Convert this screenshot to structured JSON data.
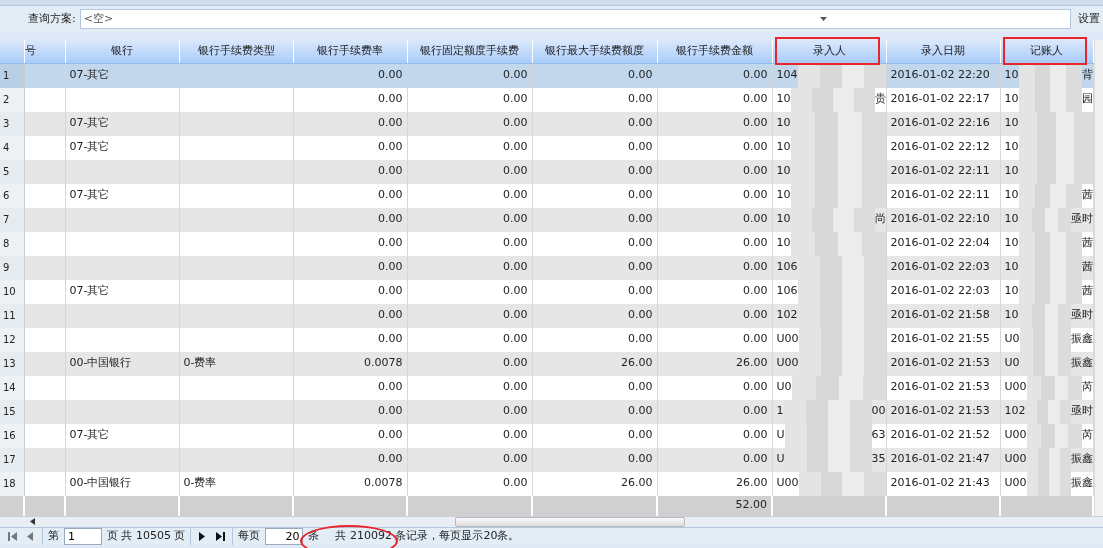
{
  "query": {
    "label": "查询方案:",
    "value": "<空>",
    "settings_button": "设置"
  },
  "table": {
    "columns": [
      {
        "label": "号",
        "highlighted": false
      },
      {
        "label": "银行",
        "highlighted": false
      },
      {
        "label": "银行手续费类型",
        "highlighted": false
      },
      {
        "label": "银行手续费率",
        "highlighted": false
      },
      {
        "label": "银行固定额度手续费",
        "highlighted": false
      },
      {
        "label": "银行最大手续费额度",
        "highlighted": false
      },
      {
        "label": "银行手续费金额",
        "highlighted": false
      },
      {
        "label": "录入人",
        "highlighted": true
      },
      {
        "label": "录入日期",
        "highlighted": false
      },
      {
        "label": "记账人",
        "highlighted": true
      }
    ],
    "rows": [
      {
        "number": "1",
        "selected": true,
        "bank": "07-其它",
        "rate": "0.00",
        "fixed": "0.00",
        "max": "0.00",
        "amount": "0.00",
        "entered_by": {
          "start": "104"
        },
        "entry_date": "2016-01-02 22:20",
        "bookkeeper": {
          "start": "10",
          "end": "背"
        }
      },
      {
        "number": "2",
        "selected": false,
        "rate": "0.00",
        "fixed": "0.00",
        "max": "0.00",
        "amount": "0.00",
        "entered_by": {
          "start": "10",
          "end": "贵"
        },
        "entry_date": "2016-01-02 22:17",
        "bookkeeper": {
          "start": "10",
          "end": "园"
        }
      },
      {
        "number": "3",
        "selected": false,
        "bank": "07-其它",
        "rate": "0.00",
        "fixed": "0.00",
        "max": "0.00",
        "amount": "0.00",
        "entered_by": {
          "start": "10"
        },
        "entry_date": "2016-01-02 22:16",
        "bookkeeper": {
          "start": "10"
        }
      },
      {
        "number": "4",
        "selected": false,
        "bank": "07-其它",
        "rate": "0.00",
        "fixed": "0.00",
        "max": "0.00",
        "amount": "0.00",
        "entered_by": {
          "start": "10"
        },
        "entry_date": "2016-01-02 22:12",
        "bookkeeper": {
          "start": "10"
        }
      },
      {
        "number": "5",
        "selected": false,
        "rate": "0.00",
        "fixed": "0.00",
        "max": "0.00",
        "amount": "0.00",
        "entered_by": {
          "start": "10"
        },
        "entry_date": "2016-01-02 22:11",
        "bookkeeper": {
          "start": "10"
        }
      },
      {
        "number": "6",
        "selected": false,
        "bank": "07-其它",
        "rate": "0.00",
        "fixed": "0.00",
        "max": "0.00",
        "amount": "0.00",
        "entered_by": {
          "start": "10"
        },
        "entry_date": "2016-01-02 22:11",
        "bookkeeper": {
          "start": "10",
          "end": "茜"
        }
      },
      {
        "number": "7",
        "selected": false,
        "rate": "0.00",
        "fixed": "0.00",
        "max": "0.00",
        "amount": "0.00",
        "entered_by": {
          "start": "10",
          "end": "尚"
        },
        "entry_date": "2016-01-02 22:10",
        "bookkeeper": {
          "start": "10",
          "end": "亟时"
        }
      },
      {
        "number": "8",
        "selected": false,
        "rate": "0.00",
        "fixed": "0.00",
        "max": "0.00",
        "amount": "0.00",
        "entered_by": {
          "start": "10"
        },
        "entry_date": "2016-01-02 22:04",
        "bookkeeper": {
          "start": "10",
          "end": "茜"
        }
      },
      {
        "number": "9",
        "selected": false,
        "rate": "0.00",
        "fixed": "0.00",
        "max": "0.00",
        "amount": "0.00",
        "entered_by": {
          "start": "106"
        },
        "entry_date": "2016-01-02 22:03",
        "bookkeeper": {
          "start": "10",
          "end": "茜"
        }
      },
      {
        "number": "10",
        "selected": false,
        "bank": "07-其它",
        "rate": "0.00",
        "fixed": "0.00",
        "max": "0.00",
        "amount": "0.00",
        "entered_by": {
          "start": "106"
        },
        "entry_date": "2016-01-02 22:03",
        "bookkeeper": {
          "start": "10",
          "end": "茜"
        }
      },
      {
        "number": "11",
        "selected": false,
        "rate": "0.00",
        "fixed": "0.00",
        "max": "0.00",
        "amount": "0.00",
        "entered_by": {
          "start": "102"
        },
        "entry_date": "2016-01-02 21:58",
        "bookkeeper": {
          "start": "10",
          "end": "亟时"
        }
      },
      {
        "number": "12",
        "selected": false,
        "rate": "0.00",
        "fixed": "0.00",
        "max": "0.00",
        "amount": "0.00",
        "entered_by": {
          "start": "U00"
        },
        "entry_date": "2016-01-02 21:55",
        "bookkeeper": {
          "start": "U0",
          "end": "振鑫"
        }
      },
      {
        "number": "13",
        "selected": false,
        "bank": "00-中国银行",
        "fee_type": "0-费率",
        "rate": "0.0078",
        "fixed": "0.00",
        "max": "26.00",
        "amount": "26.00",
        "entered_by": {
          "start": "U00"
        },
        "entry_date": "2016-01-02 21:53",
        "bookkeeper": {
          "start": "U0",
          "end": "振鑫"
        }
      },
      {
        "number": "14",
        "selected": false,
        "rate": "0.00",
        "fixed": "0.00",
        "max": "0.00",
        "amount": "0.00",
        "entered_by": {
          "start": "U0"
        },
        "entry_date": "2016-01-02 21:53",
        "bookkeeper": {
          "start": "U00",
          "end": "芮"
        }
      },
      {
        "number": "15",
        "selected": false,
        "rate": "0.00",
        "fixed": "0.00",
        "max": "0.00",
        "amount": "0.00",
        "entered_by": {
          "start": "1",
          "end": "00"
        },
        "entry_date": "2016-01-02 21:53",
        "bookkeeper": {
          "start": "102",
          "end": "亟时"
        }
      },
      {
        "number": "16",
        "selected": false,
        "bank": "07-其它",
        "rate": "0.00",
        "fixed": "0.00",
        "max": "0.00",
        "amount": "0.00",
        "entered_by": {
          "start": "U",
          "end": "63"
        },
        "entry_date": "2016-01-02 21:52",
        "bookkeeper": {
          "start": "U00",
          "end": "芮"
        }
      },
      {
        "number": "17",
        "selected": false,
        "rate": "0.00",
        "fixed": "0.00",
        "max": "0.00",
        "amount": "0.00",
        "entered_by": {
          "start": "U",
          "end": "35"
        },
        "entry_date": "2016-01-02 21:47",
        "bookkeeper": {
          "start": "U00",
          "end": "振鑫"
        }
      },
      {
        "number": "18",
        "selected": false,
        "bank": "00-中国银行",
        "fee_type": "0-费率",
        "rate": "0.0078",
        "fixed": "0.00",
        "max": "26.00",
        "amount": "26.00",
        "entered_by": {
          "start": "U00"
        },
        "entry_date": "2016-01-02 21:43",
        "bookkeeper": {
          "start": "U00",
          "end": "振鑫"
        }
      }
    ],
    "summary": {
      "amount": "52.00"
    }
  },
  "pager": {
    "page_prefix": "第",
    "page": "1",
    "page_suffix": "页 共 10505 页",
    "per_page_label": "每页",
    "per_page": "20",
    "per_page_unit": "条",
    "summary": "共 210092 条记录，每页显示20条。",
    "summary_circled": true
  }
}
